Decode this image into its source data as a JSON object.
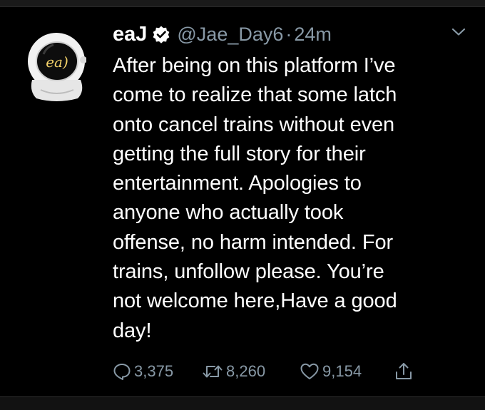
{
  "tweet": {
    "display_name": "eaJ",
    "handle": "@Jae_Day6",
    "separator": "·",
    "timestamp": "24m",
    "text": "After being on this platform I’ve\ncome to realize that some latch\nonto cancel trains without even\ngetting the full story for their\nentertainment. Apologies to\nanyone who actually took\noffense, no harm intended. For\ntrains, unfollow please. You’re\nnot welcome here,Have a good\nday!",
    "avatar_text": "ea)",
    "verified": true
  },
  "actions": {
    "replies": "3,375",
    "retweets": "8,260",
    "likes": "9,154"
  },
  "icons": {
    "reply": "reply-icon",
    "retweet": "retweet-icon",
    "like": "heart-icon",
    "share": "share-icon",
    "more": "chevron-down-icon",
    "verified": "verified-badge-icon"
  },
  "colors": {
    "background": "#000000",
    "text": "#ffffff",
    "secondary": "#8899a6"
  }
}
